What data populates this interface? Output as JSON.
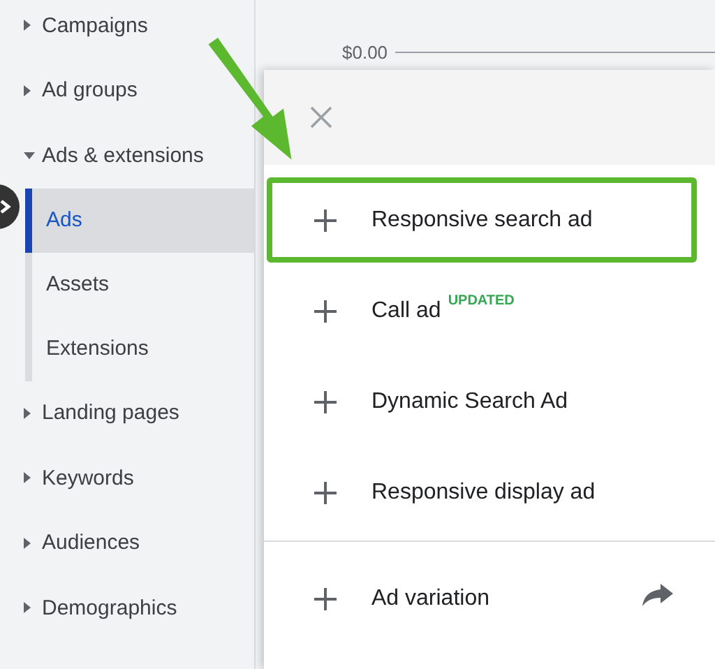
{
  "sidebar": {
    "items": [
      {
        "label": "Campaigns",
        "expanded": false
      },
      {
        "label": "Ad groups",
        "expanded": false
      },
      {
        "label": "Ads & extensions",
        "expanded": true,
        "children": [
          {
            "label": "Ads",
            "selected": true
          },
          {
            "label": "Assets",
            "selected": false
          },
          {
            "label": "Extensions",
            "selected": false
          }
        ]
      },
      {
        "label": "Landing pages",
        "expanded": false
      },
      {
        "label": "Keywords",
        "expanded": false
      },
      {
        "label": "Audiences",
        "expanded": false
      },
      {
        "label": "Demographics",
        "expanded": false
      }
    ]
  },
  "chart": {
    "axis_label": "$0.00"
  },
  "menu": {
    "groups": [
      [
        {
          "label": "Responsive search ad",
          "highlighted": true,
          "kind": "create"
        },
        {
          "label": "Call ad",
          "badge": "UPDATED",
          "highlighted": false,
          "kind": "create"
        },
        {
          "label": "Dynamic Search Ad",
          "highlighted": false,
          "kind": "create"
        },
        {
          "label": "Responsive display ad",
          "highlighted": false,
          "kind": "create"
        }
      ],
      [
        {
          "label": "Ad variation",
          "highlighted": false,
          "kind": "link"
        }
      ]
    ]
  }
}
